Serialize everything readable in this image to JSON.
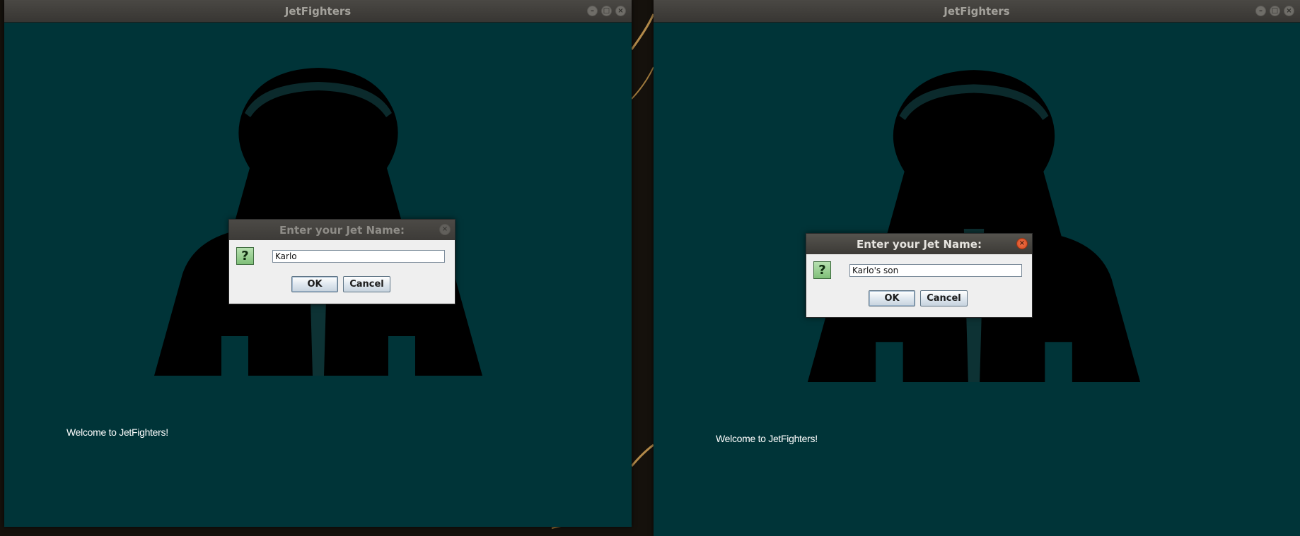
{
  "windows": [
    {
      "title": "JetFighters",
      "welcome_text": "Welcome to JetFighters!",
      "dialog": {
        "title": "Enter your Jet Name:",
        "icon": "question-icon",
        "icon_glyph": "?",
        "input_value": "Karlo",
        "ok_label": "OK",
        "cancel_label": "Cancel",
        "state": "inactive"
      }
    },
    {
      "title": "JetFighters",
      "welcome_text": "Welcome to JetFighters!",
      "dialog": {
        "title": "Enter your Jet Name:",
        "icon": "question-icon",
        "icon_glyph": "?",
        "input_value": "Karlo's son",
        "ok_label": "OK",
        "cancel_label": "Cancel",
        "state": "active"
      }
    }
  ],
  "window_controls": {
    "minimize_glyph": "–",
    "maximize_glyph": "□",
    "close_glyph": "×"
  },
  "colors": {
    "game_background": "#003438",
    "titlebar": "#3c3a37",
    "dialog_background": "#efefef",
    "active_close": "#e0522a"
  }
}
